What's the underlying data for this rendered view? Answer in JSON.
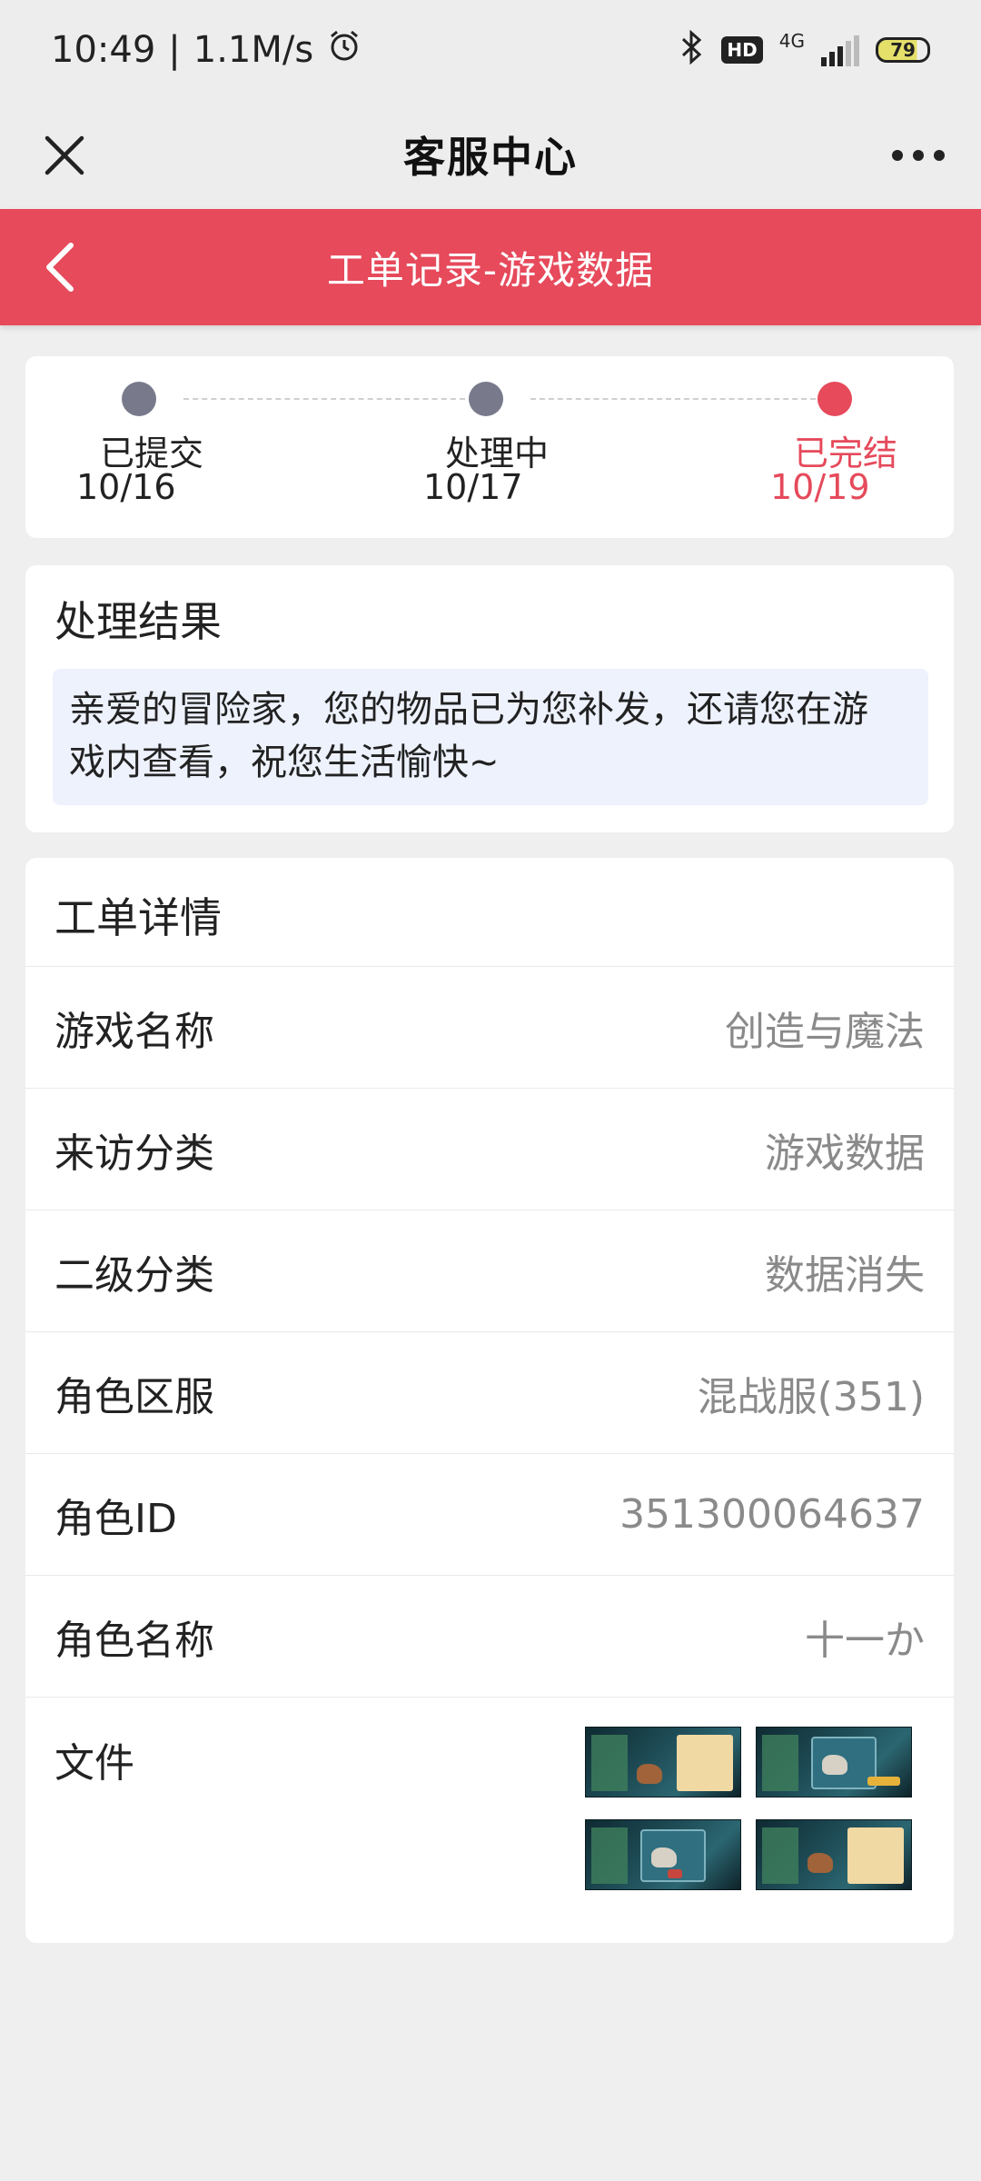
{
  "status_bar": {
    "time": "10:49",
    "speed": "1.1M/s",
    "network": "4G",
    "hd": "HD",
    "battery": "79"
  },
  "nav": {
    "title": "客服中心",
    "close_icon": "close-icon",
    "more_icon": "more-dots-icon"
  },
  "header": {
    "title": "工单记录-游戏数据",
    "back_icon": "chevron-left-icon",
    "color": "#e64a5b"
  },
  "progress": {
    "steps": [
      {
        "label": "已提交",
        "date": "10/16",
        "state": "done-grey"
      },
      {
        "label": "处理中",
        "date": "10/17",
        "state": "done-grey"
      },
      {
        "label": "已完结",
        "date": "10/19",
        "state": "current"
      }
    ],
    "active_color": "#e64a5b",
    "inactive_color": "#787a8c"
  },
  "result": {
    "title": "处理结果",
    "line1": "亲爱的冒险家，您的物品已为您补发，还请您在游",
    "line2": "戏内查看，祝您生活愉快~"
  },
  "details": {
    "title": "工单详情",
    "rows": [
      {
        "label": "游戏名称",
        "value": "创造与魔法"
      },
      {
        "label": "来访分类",
        "value": "游戏数据"
      },
      {
        "label": "二级分类",
        "value": "数据消失"
      },
      {
        "label": "角色区服",
        "value": "混战服(351)"
      },
      {
        "label": "角色ID",
        "value": "351300064637"
      },
      {
        "label": "角色名称",
        "value": "十一か"
      }
    ],
    "files_label": "文件",
    "files_count": 4
  }
}
